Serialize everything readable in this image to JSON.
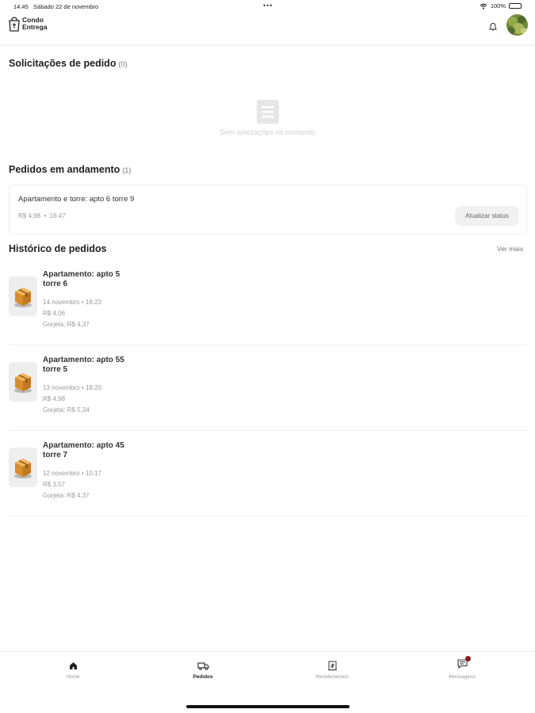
{
  "status_bar": {
    "time": "14:45",
    "date": "Sábado 22 de novembro",
    "dots": "•••",
    "battery": "100%",
    "icons": [
      "wifi-icon",
      "battery-icon"
    ]
  },
  "header": {
    "logo_line1": "Condo",
    "logo_line2": "Entrega",
    "icons": [
      "shopping-bag-icon",
      "bell-icon",
      "avatar"
    ]
  },
  "requests": {
    "title": "Solicitações de pedido",
    "count": "(0)",
    "empty_text": "Sem solicitações no momento",
    "empty_icon": "document-icon"
  },
  "in_progress": {
    "title": "Pedidos em andamento",
    "count": "(1)",
    "orders": [
      {
        "title": "Apartamento e torre: apto 6 torre 9",
        "price": "R$ 4,98",
        "separator": "•",
        "time": "16:47",
        "button": "Atualizar status"
      }
    ]
  },
  "history": {
    "title": "Histórico de pedidos",
    "see_more": "Ver mais",
    "items": [
      {
        "title": "Apartamento: apto 5 torre 6",
        "date": "14 novembro • 16:23",
        "price": "R$ 4,06",
        "tip": "Gorjeta: R$ 4,37",
        "icon": "package-box-icon"
      },
      {
        "title": "Apartamento: apto 55 torre 5",
        "date": "13 novembro • 18:20",
        "price": "R$ 4,98",
        "tip": "Gorjeta: R$ 5,34",
        "icon": "package-box-icon"
      },
      {
        "title": "Apartamento: apto 45 torre 7",
        "date": "12 novembro • 10:17",
        "price": "R$ 3,57",
        "tip": "Gorjeta: R$ 4,37",
        "icon": "package-box-icon"
      }
    ]
  },
  "tabbar": {
    "tabs": [
      {
        "label": "Home",
        "icon": "home-icon",
        "active": false
      },
      {
        "label": "Pedidos",
        "icon": "truck-icon",
        "active": true
      },
      {
        "label": "Recebimentos",
        "icon": "receipt-icon",
        "active": false
      },
      {
        "label": "Mensagens",
        "icon": "message-icon",
        "active": false,
        "badge": true
      }
    ]
  },
  "colors": {
    "badge": "#8b1a1a",
    "box": "#e8a642",
    "text_primary": "#1f1f1f",
    "text_muted": "#999999"
  }
}
